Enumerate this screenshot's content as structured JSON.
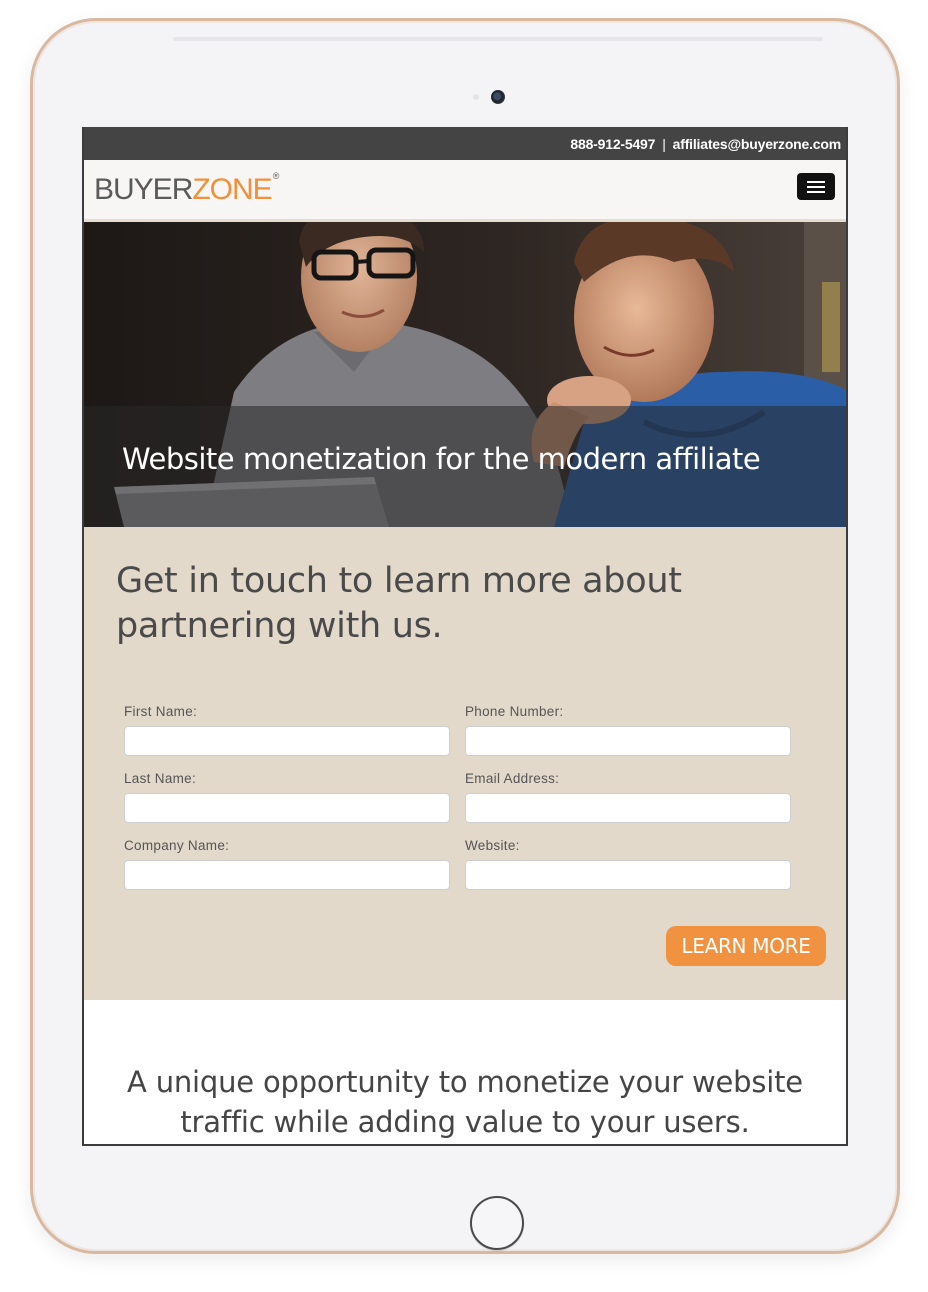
{
  "topbar": {
    "phone": "888-912-5497",
    "separator": "|",
    "email": "affiliates@buyerzone.com"
  },
  "header": {
    "logo_buyer": "BUYER",
    "logo_zone": "ZONE",
    "logo_mark": "®",
    "menu_icon": "hamburger-menu-icon"
  },
  "hero": {
    "title": "Website monetization for the modern affiliate"
  },
  "contact": {
    "heading": "Get in touch to learn more about partnering with us.",
    "fields": {
      "first_name": {
        "label": "First Name:",
        "value": ""
      },
      "phone": {
        "label": "Phone Number:",
        "value": ""
      },
      "last_name": {
        "label": "Last Name:",
        "value": ""
      },
      "email": {
        "label": "Email Address:",
        "value": ""
      },
      "company": {
        "label": "Company Name:",
        "value": ""
      },
      "website": {
        "label": "Website:",
        "value": ""
      }
    },
    "submit_label": "LEARN MORE"
  },
  "lower": {
    "heading": "A unique opportunity to monetize your website traffic while adding value to your users."
  },
  "colors": {
    "brand_orange": "#f0903a",
    "topbar_bg": "#444444",
    "form_bg": "#e2d9ca",
    "text_dark": "#4a4a4a"
  }
}
